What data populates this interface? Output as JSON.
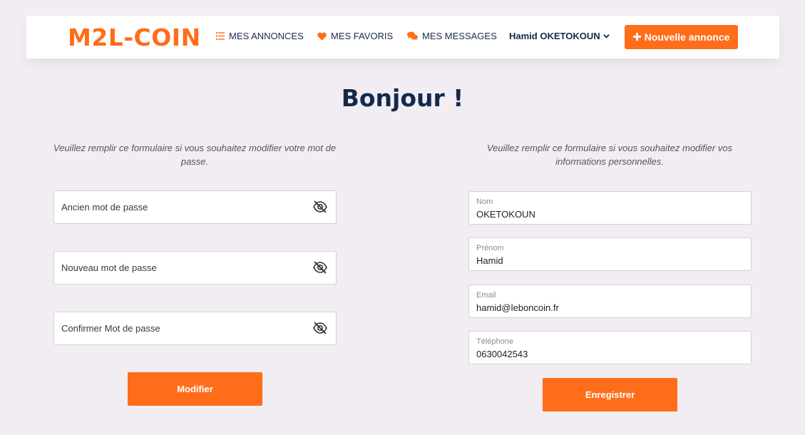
{
  "brand": {
    "name": "M2L-COIN",
    "accent_color": "#ff6d1a",
    "title_color": "#142a4c"
  },
  "nav": {
    "annonces": {
      "label": "MES ANNONCES",
      "icon": "list-icon"
    },
    "favoris": {
      "label": "MES FAVORIS",
      "icon": "heart-icon"
    },
    "messages": {
      "label": "MES MESSAGES",
      "icon": "chat-bubbles-icon"
    },
    "user": {
      "label": "Hamid OKETOKOUN",
      "icon": "chevron-down-icon"
    },
    "new_listing": {
      "label": "Nouvelle annonce",
      "icon": "plus-icon"
    }
  },
  "page": {
    "title": "Bonjour !"
  },
  "password_form": {
    "intro": "Veuillez remplir ce formulaire si vous souhaitez modifier votre mot de passe.",
    "old_password": {
      "placeholder": "Ancien mot de passe",
      "icon": "eye-slash-icon"
    },
    "new_password": {
      "placeholder": "Nouveau mot de passe",
      "icon": "eye-slash-icon"
    },
    "confirm_password": {
      "placeholder": "Confirmer Mot de passe",
      "icon": "eye-slash-icon"
    },
    "submit_label": "Modifier"
  },
  "info_form": {
    "intro": "Veuillez remplir ce formulaire si vous souhaitez modifier vos informations personnelles.",
    "nom": {
      "label": "Nom",
      "value": "OKETOKOUN"
    },
    "prenom": {
      "label": "Prénom",
      "value": "Hamid"
    },
    "email": {
      "label": "Email",
      "value": "hamid@leboncoin.fr"
    },
    "telephone": {
      "label": "Téléphone",
      "value": "0630042543"
    },
    "submit_label": "Enregistrer"
  }
}
